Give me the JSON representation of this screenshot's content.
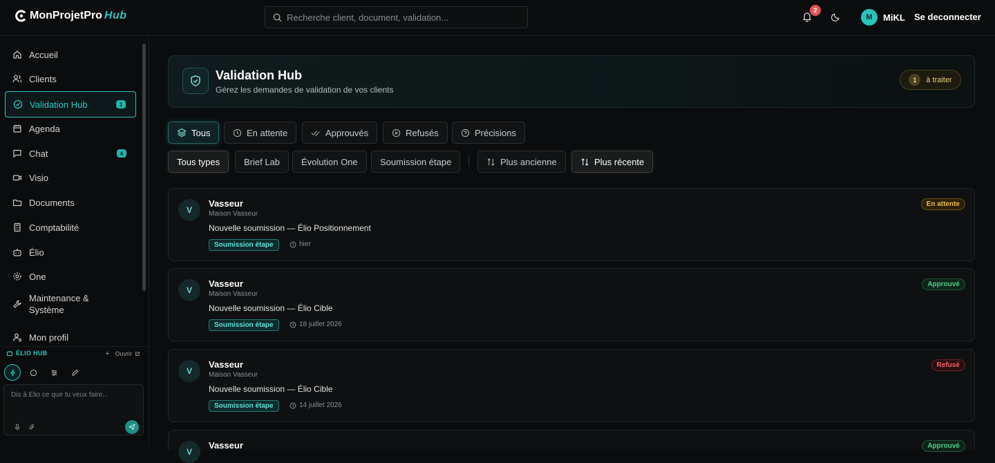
{
  "app": {
    "brand_main": "MonProjetPro",
    "brand_hub": "Hub"
  },
  "search": {
    "placeholder": "Recherche client, document, validation..."
  },
  "notifications": {
    "count": "2"
  },
  "user": {
    "initial": "M",
    "name": "MiKL"
  },
  "logout_label": "Se deconnecter",
  "sidebar": {
    "items": [
      {
        "label": "Accueil",
        "icon": "home-icon"
      },
      {
        "label": "Clients",
        "icon": "users-icon"
      },
      {
        "label": "Validation Hub",
        "icon": "check-circle-icon",
        "count": "1",
        "active": true
      },
      {
        "label": "Agenda",
        "icon": "calendar-icon"
      },
      {
        "label": "Chat",
        "icon": "chat-icon",
        "count": "4"
      },
      {
        "label": "Visio",
        "icon": "video-icon"
      },
      {
        "label": "Documents",
        "icon": "folder-icon"
      },
      {
        "label": "Comptabilité",
        "icon": "calculator-icon"
      },
      {
        "label": "Élio",
        "icon": "bot-icon"
      },
      {
        "label": "One",
        "icon": "gear-icon"
      },
      {
        "label": "Maintenance & Système",
        "icon": "wrench-icon"
      },
      {
        "label": "Mon profil",
        "icon": "user-gear-icon"
      }
    ]
  },
  "elio": {
    "title": "ÉLIO HUB",
    "open_label": "Ouvrir",
    "placeholder": "Dis à Élio ce que tu veux faire..."
  },
  "header": {
    "title": "Validation Hub",
    "subtitle": "Gérez les demandes de validation de vos clients",
    "todo_count": "1",
    "todo_label": "à traiter"
  },
  "status_filters": [
    "Tous",
    "En attente",
    "Approuvés",
    "Refusés",
    "Précisions"
  ],
  "type_filters": [
    "Tous types",
    "Brief Lab",
    "Évolution One",
    "Soumission étape"
  ],
  "sort": {
    "oldest": "Plus ancienne",
    "newest": "Plus récente"
  },
  "requests": [
    {
      "initial": "V",
      "client": "Vasseur",
      "company": "Maison Vasseur",
      "title": "Nouvelle soumission — Élio Positionnement",
      "type": "Soumission étape",
      "date": "hier",
      "status": "En attente"
    },
    {
      "initial": "V",
      "client": "Vasseur",
      "company": "Maison Vasseur",
      "title": "Nouvelle soumission — Élio Cible",
      "type": "Soumission étape",
      "date": "18 juillet 2026",
      "status": "Approuvé"
    },
    {
      "initial": "V",
      "client": "Vasseur",
      "company": "Maison Vasseur",
      "title": "Nouvelle soumission — Élio Cible",
      "type": "Soumission étape",
      "date": "14 juillet 2026",
      "status": "Refusé"
    },
    {
      "initial": "V",
      "client": "Vasseur",
      "status": "Approuvé"
    }
  ],
  "colors": {
    "accent": "#2ec4c0",
    "pending": "#f0b94a",
    "approved": "#4fd08a",
    "refused": "#f06262"
  }
}
